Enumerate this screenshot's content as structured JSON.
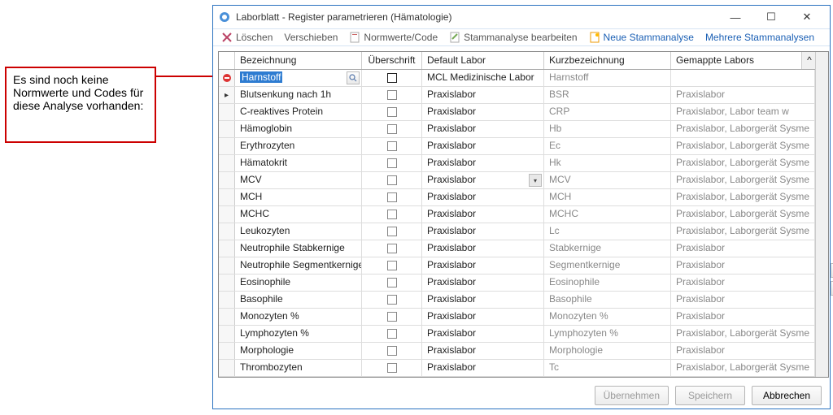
{
  "annotation": {
    "text": "Es sind noch keine Normwerte und Codes für diese Analyse vorhanden:"
  },
  "window": {
    "title": "Laborblatt - Register parametrieren (Hämatologie)"
  },
  "toolbar": {
    "loeschen": "Löschen",
    "verschieben": "Verschieben",
    "normwerte": "Normwerte/Code",
    "stamm_bearbeiten": "Stammanalyse bearbeiten",
    "neue_stamm": "Neue Stammanalyse",
    "mehrere_stamm": "Mehrere Stammanalysen"
  },
  "grid": {
    "headers": {
      "bezeichnung": "Bezeichnung",
      "ueberschrift": "Überschrift",
      "default_labor": "Default Labor",
      "kurz": "Kurzbezeichnung",
      "gemappte": "Gemappte Labors"
    },
    "rows": [
      {
        "sel": "err",
        "bez": "Harnstoff",
        "bez_hl": true,
        "bez_btn": true,
        "ue_bold": true,
        "lab": "MCL Medizinische Labor",
        "kurz": "Harnstoff",
        "map": ""
      },
      {
        "sel": "cur",
        "bez": "Blutsenkung nach 1h",
        "lab": "Praxislabor",
        "kurz": "BSR",
        "map": "Praxislabor"
      },
      {
        "bez": "C-reaktives Protein",
        "lab": "Praxislabor",
        "kurz": "CRP",
        "map": "Praxislabor, Labor team w"
      },
      {
        "bez": "Hämoglobin",
        "lab": "Praxislabor",
        "kurz": "Hb",
        "map": "Praxislabor, Laborgerät Sysme"
      },
      {
        "bez": "Erythrozyten",
        "lab": "Praxislabor",
        "kurz": "Ec",
        "map": "Praxislabor, Laborgerät Sysme"
      },
      {
        "bez": "Hämatokrit",
        "lab": "Praxislabor",
        "kurz": "Hk",
        "map": "Praxislabor, Laborgerät Sysme"
      },
      {
        "bez": "MCV",
        "lab": "Praxislabor",
        "lab_dd": true,
        "kurz": "MCV",
        "map": "Praxislabor, Laborgerät Sysme"
      },
      {
        "bez": "MCH",
        "lab": "Praxislabor",
        "kurz": "MCH",
        "map": "Praxislabor, Laborgerät Sysme"
      },
      {
        "bez": "MCHC",
        "lab": "Praxislabor",
        "kurz": "MCHC",
        "map": "Praxislabor, Laborgerät Sysme"
      },
      {
        "bez": "Leukozyten",
        "lab": "Praxislabor",
        "kurz": "Lc",
        "map": "Praxislabor, Laborgerät Sysme"
      },
      {
        "bez": "Neutrophile Stabkernige",
        "lab": "Praxislabor",
        "kurz": "Stabkernige",
        "map": "Praxislabor"
      },
      {
        "bez": "Neutrophile Segmentkernige",
        "lab": "Praxislabor",
        "kurz": "Segmentkernige",
        "map": "Praxislabor"
      },
      {
        "bez": "Eosinophile",
        "lab": "Praxislabor",
        "kurz": "Eosinophile",
        "map": "Praxislabor"
      },
      {
        "bez": "Basophile",
        "lab": "Praxislabor",
        "kurz": "Basophile",
        "map": "Praxislabor"
      },
      {
        "bez": "Monozyten %",
        "lab": "Praxislabor",
        "kurz": "Monozyten %",
        "map": "Praxislabor"
      },
      {
        "bez": "Lymphozyten %",
        "lab": "Praxislabor",
        "kurz": "Lymphozyten %",
        "map": "Praxislabor, Laborgerät Sysme"
      },
      {
        "bez": "Morphologie",
        "lab": "Praxislabor",
        "kurz": "Morphologie",
        "map": "Praxislabor"
      },
      {
        "bez": "Thrombozyten",
        "lab": "Praxislabor",
        "kurz": "Tc",
        "map": "Praxislabor, Laborgerät Sysme"
      }
    ]
  },
  "footer": {
    "uebernehmen": "Übernehmen",
    "speichern": "Speichern",
    "abbrechen": "Abbrechen"
  }
}
